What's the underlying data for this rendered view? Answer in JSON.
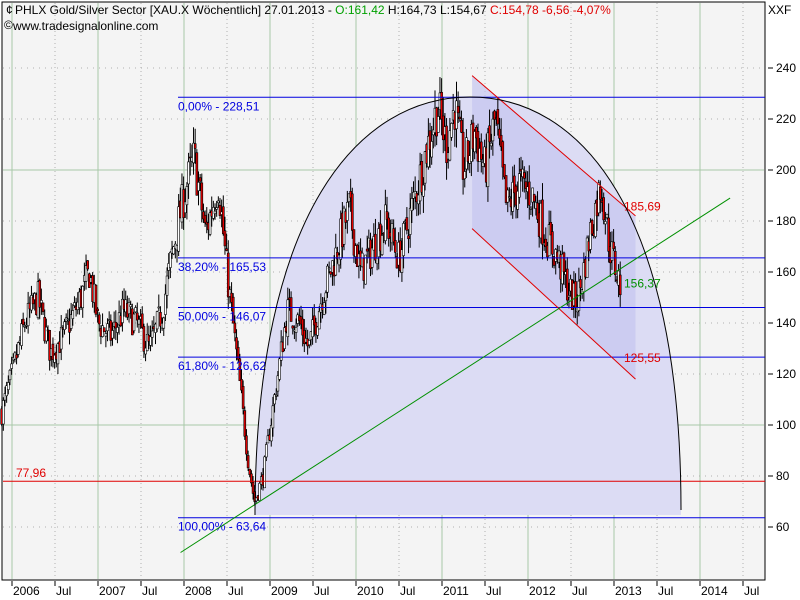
{
  "header": {
    "title": "PHLX Gold/Silver Sector [XAU.X  Wöchentlich] 27.01.2013 -",
    "open": "O:161,42",
    "high": "H:164,73",
    "low": "L:154,67",
    "close": "C:154,78 -6,56 -4,07%",
    "copyright": "www.tradesignalonline.com",
    "corner": "XXF"
  },
  "colors": {
    "up": "#ffffff",
    "down": "#e00000",
    "fib": "#0000e0",
    "support": "#e00000",
    "channel": "#e00000",
    "trend": "#009000",
    "arc_fill": "#dcdcf4",
    "channel_fill": "#c4c4f0"
  },
  "chart_data": {
    "type": "candlestick",
    "title": "PHLX Gold/Silver Sector [XAU.X Wöchentlich]",
    "xlim": [
      2005.88,
      2013.87
    ],
    "ylim": [
      55,
      252
    ],
    "yticks": [
      "60",
      "80",
      "100",
      "120",
      "140",
      "160",
      "180",
      "200",
      "220",
      "240"
    ],
    "xticks": [
      {
        "t": 2006,
        "label": "2006"
      },
      {
        "t": 2006.5,
        "label": "Jul"
      },
      {
        "t": 2007,
        "label": "2007"
      },
      {
        "t": 2007.5,
        "label": "Jul"
      },
      {
        "t": 2008,
        "label": "2008"
      },
      {
        "t": 2008.5,
        "label": "Jul"
      },
      {
        "t": 2009,
        "label": "2009"
      },
      {
        "t": 2009.5,
        "label": "Jul"
      },
      {
        "t": 2010,
        "label": "2010"
      },
      {
        "t": 2010.5,
        "label": "Jul"
      },
      {
        "t": 2011,
        "label": "2011"
      },
      {
        "t": 2011.5,
        "label": "Jul"
      },
      {
        "t": 2012,
        "label": "2012"
      },
      {
        "t": 2012.5,
        "label": "Jul"
      },
      {
        "t": 2013,
        "label": "2013"
      },
      {
        "t": 2013.5,
        "label": "Jul"
      },
      {
        "t": 2014,
        "label": "2014"
      },
      {
        "t": 2014.5,
        "label": "Jul"
      }
    ],
    "price_anchors": [
      [
        2005.88,
        105
      ],
      [
        2006.0,
        120
      ],
      [
        2006.15,
        140
      ],
      [
        2006.3,
        150
      ],
      [
        2006.45,
        128
      ],
      [
        2006.6,
        135
      ],
      [
        2006.8,
        150
      ],
      [
        2006.9,
        160
      ],
      [
        2007.0,
        140
      ],
      [
        2007.15,
        135
      ],
      [
        2007.3,
        145
      ],
      [
        2007.45,
        140
      ],
      [
        2007.6,
        130
      ],
      [
        2007.75,
        145
      ],
      [
        2007.85,
        165
      ],
      [
        2008.0,
        190
      ],
      [
        2008.12,
        205
      ],
      [
        2008.25,
        175
      ],
      [
        2008.4,
        195
      ],
      [
        2008.5,
        160
      ],
      [
        2008.62,
        125
      ],
      [
        2008.75,
        85
      ],
      [
        2008.82,
        70
      ],
      [
        2008.92,
        80
      ],
      [
        2009.05,
        110
      ],
      [
        2009.2,
        145
      ],
      [
        2009.35,
        140
      ],
      [
        2009.45,
        130
      ],
      [
        2009.6,
        150
      ],
      [
        2009.75,
        165
      ],
      [
        2009.92,
        185
      ],
      [
        2010.05,
        160
      ],
      [
        2010.2,
        170
      ],
      [
        2010.35,
        180
      ],
      [
        2010.5,
        165
      ],
      [
        2010.65,
        185
      ],
      [
        2010.8,
        205
      ],
      [
        2010.95,
        225
      ],
      [
        2011.05,
        210
      ],
      [
        2011.15,
        225
      ],
      [
        2011.25,
        200
      ],
      [
        2011.38,
        215
      ],
      [
        2011.5,
        200
      ],
      [
        2011.62,
        220
      ],
      [
        2011.75,
        185
      ],
      [
        2011.9,
        195
      ],
      [
        2012.05,
        190
      ],
      [
        2012.2,
        175
      ],
      [
        2012.35,
        165
      ],
      [
        2012.45,
        155
      ],
      [
        2012.55,
        148
      ],
      [
        2012.62,
        155
      ],
      [
        2012.72,
        175
      ],
      [
        2012.85,
        195
      ],
      [
        2012.95,
        170
      ],
      [
        2013.07,
        155
      ]
    ],
    "fib_levels": [
      {
        "pct": "0,00%",
        "value": 228.51,
        "label": "0,00% - 228,51"
      },
      {
        "pct": "38,20%",
        "value": 165.53,
        "label": "38,20% - 165,53"
      },
      {
        "pct": "50,00%",
        "value": 146.07,
        "label": "50,00% - 146,07"
      },
      {
        "pct": "61,80%",
        "value": 126.62,
        "label": "61,80% - 126,62"
      },
      {
        "pct": "100,00%",
        "value": 63.64,
        "label": "100,00% - 63,64"
      }
    ],
    "support": {
      "value": 77.96,
      "label": "77,96"
    },
    "channel_upper": {
      "from": [
        2011.35,
        237
      ],
      "to": [
        2013.25,
        182
      ],
      "label": "185,69"
    },
    "channel_lower": {
      "from": [
        2011.35,
        177
      ],
      "to": [
        2013.25,
        118
      ],
      "label": "125,55"
    },
    "trendline": {
      "from": [
        2007.96,
        50
      ],
      "to": [
        2014.35,
        189
      ],
      "label": "156,37"
    }
  }
}
